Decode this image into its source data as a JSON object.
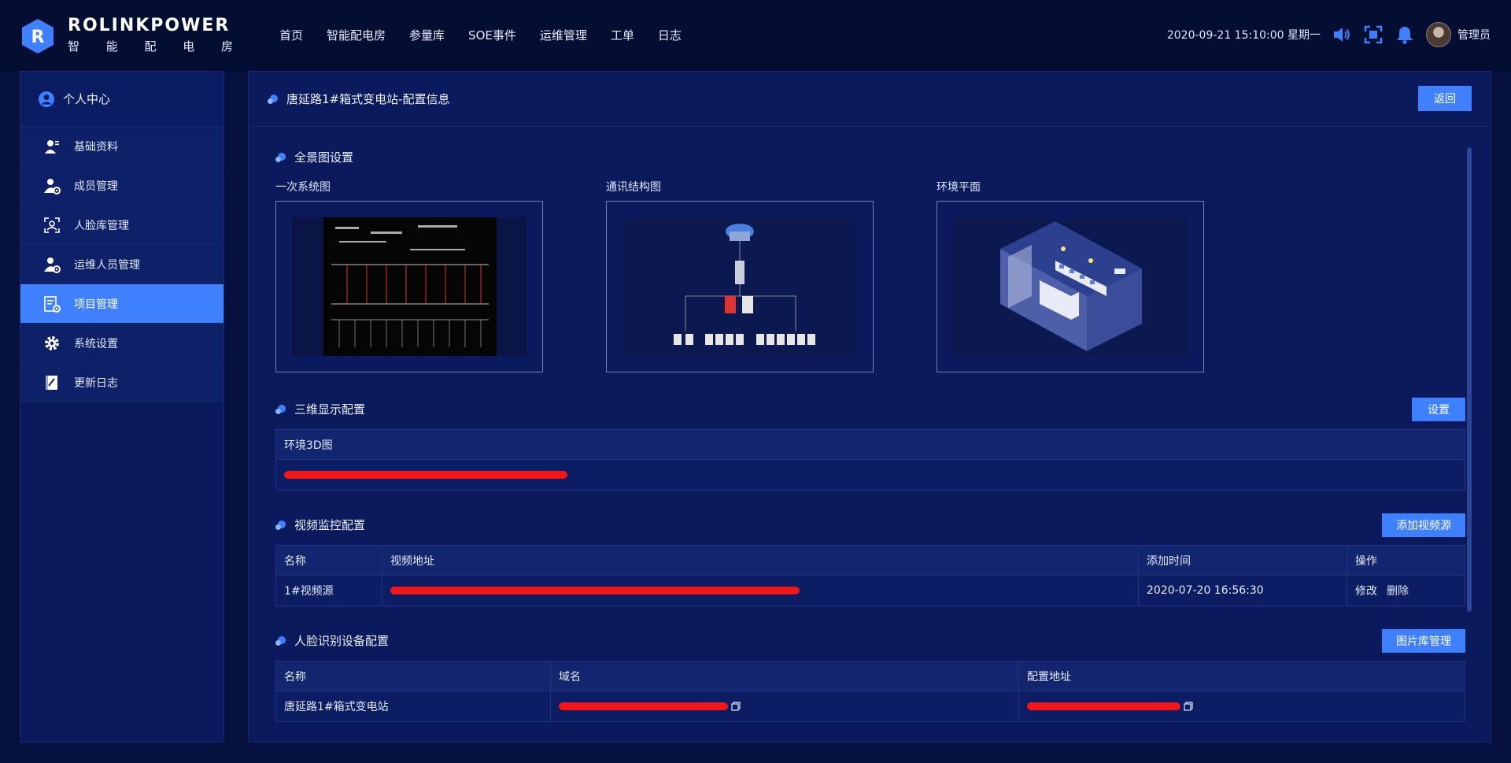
{
  "brand": {
    "title": "ROLINKPOWER",
    "subtitle_chars": [
      "智",
      "能",
      "配",
      "电",
      "房"
    ]
  },
  "nav": [
    "首页",
    "智能配电房",
    "参量库",
    "SOE事件",
    "运维管理",
    "工单",
    "日志"
  ],
  "header": {
    "datetime": "2020-09-21 15:10:00 星期一",
    "username": "管理员"
  },
  "sidebar": {
    "head": "个人中心",
    "items": [
      {
        "label": "基础资料",
        "icon": "profile-icon"
      },
      {
        "label": "成员管理",
        "icon": "user-gear-icon"
      },
      {
        "label": "人脸库管理",
        "icon": "face-scan-icon"
      },
      {
        "label": "运维人员管理",
        "icon": "maintainer-icon"
      },
      {
        "label": "项目管理",
        "icon": "project-icon",
        "active": true
      },
      {
        "label": "系统设置",
        "icon": "gear-icon"
      },
      {
        "label": "更新日志",
        "icon": "notebook-icon"
      }
    ]
  },
  "page": {
    "title": "唐延路1#箱式变电站-配置信息",
    "back": "返回"
  },
  "panorama": {
    "title": "全景图设置",
    "images": [
      {
        "label": "一次系统图"
      },
      {
        "label": "通讯结构图"
      },
      {
        "label": "环境平面"
      }
    ]
  },
  "three_d": {
    "title": "三维显示配置",
    "button": "设置",
    "header": "环境3D图",
    "value_redacted": true
  },
  "video": {
    "title": "视频监控配置",
    "button": "添加视频源",
    "columns": [
      "名称",
      "视频地址",
      "添加时间",
      "操作"
    ],
    "rows": [
      {
        "name": "1#视频源",
        "url_redacted": true,
        "time": "2020-07-20 16:56:30",
        "edit": "修改",
        "delete": "删除"
      }
    ]
  },
  "face": {
    "title": "人脸识别设备配置",
    "button": "图片库管理",
    "columns": [
      "名称",
      "域名",
      "配置地址"
    ],
    "rows": [
      {
        "name": "唐延路1#箱式变电站",
        "domain_redacted": true,
        "config_redacted": true
      }
    ]
  },
  "colors": {
    "accent": "#3f80ff",
    "bg": "#061140",
    "panel": "#0a1a5c",
    "redaction": "#f0161a"
  }
}
